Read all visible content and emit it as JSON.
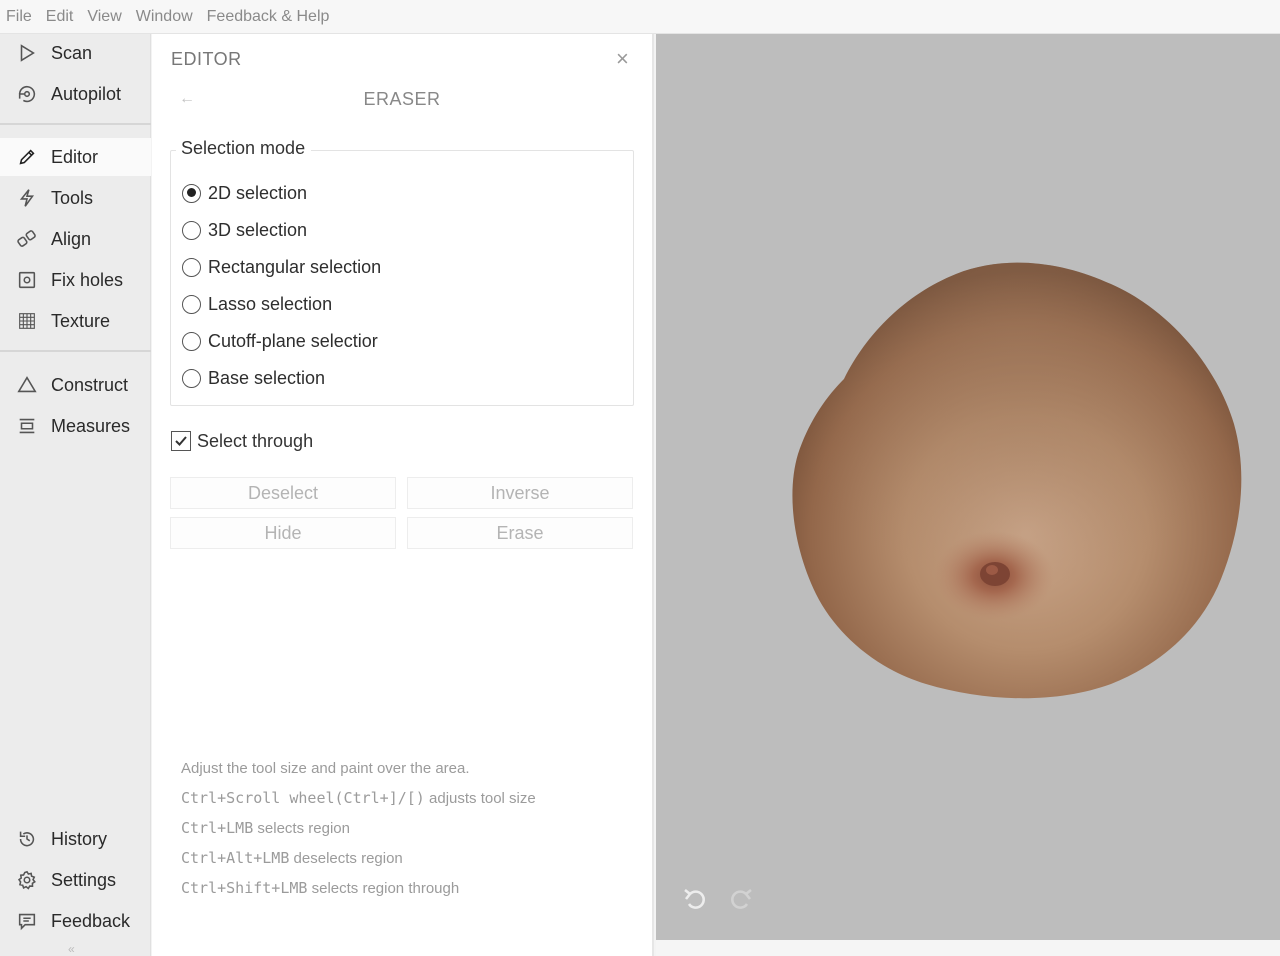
{
  "menubar": {
    "items": [
      "File",
      "Edit",
      "View",
      "Window",
      "Feedback & Help"
    ]
  },
  "sidebar": {
    "items": [
      {
        "label": "Scan",
        "icon": "play-icon"
      },
      {
        "label": "Autopilot",
        "icon": "autopilot-icon"
      },
      {
        "label": "Editor",
        "icon": "pencil-icon",
        "active": true
      },
      {
        "label": "Tools",
        "icon": "lightning-icon"
      },
      {
        "label": "Align",
        "icon": "align-icon"
      },
      {
        "label": "Fix holes",
        "icon": "fix-holes-icon"
      },
      {
        "label": "Texture",
        "icon": "texture-icon"
      },
      {
        "label": "Construct",
        "icon": "triangle-icon"
      },
      {
        "label": "Measures",
        "icon": "ruler-icon"
      },
      {
        "label": "History",
        "icon": "history-icon"
      },
      {
        "label": "Settings",
        "icon": "gear-icon"
      },
      {
        "label": "Feedback",
        "icon": "chat-icon"
      }
    ],
    "collapse_glyph": "«"
  },
  "panel": {
    "title": "EDITOR",
    "close_glyph": "×",
    "back_glyph": "←",
    "subtitle": "ERASER",
    "selection_mode": {
      "legend": "Selection mode",
      "options": [
        "2D selection",
        "3D selection",
        "Rectangular selection",
        "Lasso selection",
        "Cutoff-plane selectior",
        "Base selection"
      ],
      "selected_index": 0
    },
    "select_through": {
      "label": "Select through",
      "checked": true
    },
    "buttons": {
      "deselect": "Deselect",
      "inverse": "Inverse",
      "hide": "Hide",
      "erase": "Erase"
    },
    "hints": {
      "line1": "Adjust the tool size and paint over the area.",
      "line2_keys": "Ctrl+Scroll wheel(Ctrl+]/[)",
      "line2_text": " adjusts tool size",
      "line3_keys": "Ctrl+LMB",
      "line3_text": " selects region",
      "line4_keys": "Ctrl+Alt+LMB",
      "line4_text": " deselects region",
      "line5_keys": "Ctrl+Shift+LMB",
      "line5_text": " selects region through"
    }
  },
  "viewport": {
    "background": "#bdbdbd",
    "undo_icon": "undo-icon",
    "redo_icon": "redo-icon"
  }
}
